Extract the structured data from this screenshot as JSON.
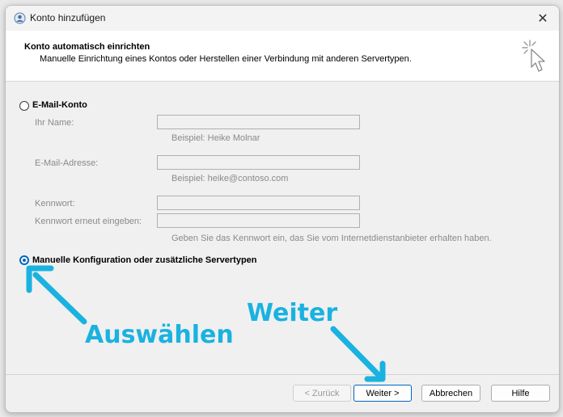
{
  "window": {
    "title": "Konto hinzufügen",
    "close_glyph": "✕"
  },
  "header": {
    "title": "Konto automatisch einrichten",
    "subtitle": "Manuelle Einrichtung eines Kontos oder Herstellen einer Verbindung mit anderen Servertypen."
  },
  "options": {
    "email_account_label": "E-Mail-Konto",
    "email_account_selected": false,
    "manual_config_label": "Manuelle Konfiguration oder zusätzliche Servertypen",
    "manual_config_selected": true
  },
  "form": {
    "name_label": "Ihr Name:",
    "name_value": "",
    "name_example": "Beispiel: Heike Molnar",
    "email_label": "E-Mail-Adresse:",
    "email_value": "",
    "email_example": "Beispiel: heike@contoso.com",
    "password_label": "Kennwort:",
    "password_value": "",
    "password_repeat_label": "Kennwort erneut eingeben:",
    "password_repeat_value": "",
    "password_hint": "Geben Sie das Kennwort ein, das Sie vom Internetdienstanbieter erhalten haben."
  },
  "buttons": {
    "back": "< Zurück",
    "next": "Weiter >",
    "cancel": "Abbrechen",
    "help": "Hilfe"
  },
  "annotations": {
    "select_text": "Auswählen",
    "next_text": "Weiter",
    "color": "#1ab2e0"
  },
  "icons": {
    "app": "outlook-account-icon",
    "wizard": "cursor-click-icon",
    "close": "close-icon"
  }
}
